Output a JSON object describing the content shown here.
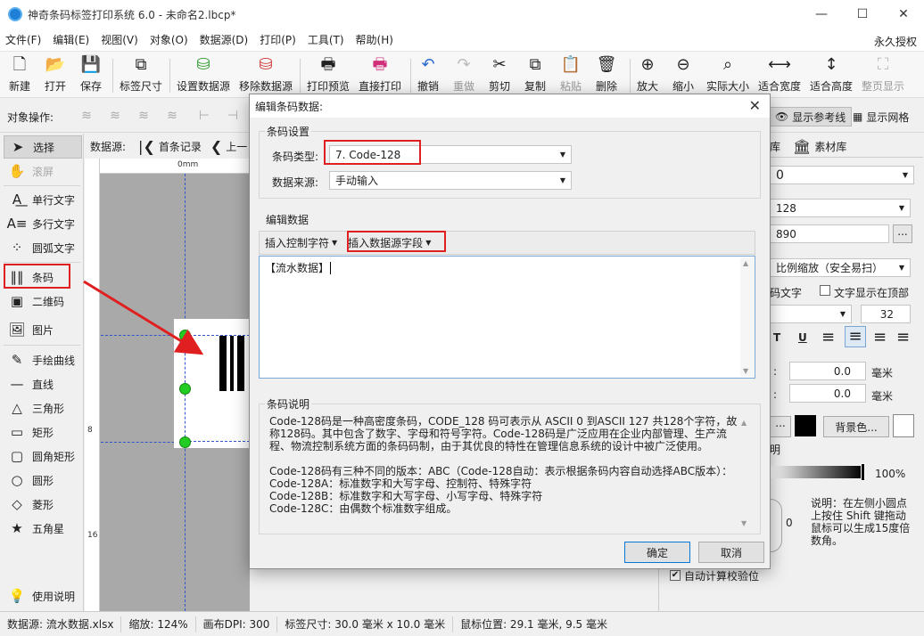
{
  "window": {
    "title": "神奇条码标签打印系统 6.0 - 未命名2.lbcp*",
    "minimize": "—",
    "maximize": "☐",
    "close": "✕"
  },
  "menu": {
    "items": [
      "文件(F)",
      "编辑(E)",
      "视图(V)",
      "对象(O)",
      "数据源(D)",
      "打印(P)",
      "工具(T)",
      "帮助(H)"
    ],
    "right": "永久授权"
  },
  "toolbar": {
    "new": "新建",
    "open": "打开",
    "save": "保存",
    "label_size": "标签尺寸",
    "set_datasource": "设置数据源",
    "remove_datasource": "移除数据源",
    "print_preview": "打印预览",
    "direct_print": "直接打印",
    "undo": "撤销",
    "redo": "重做",
    "cut": "剪切",
    "copy": "复制",
    "paste": "粘贴",
    "delete": "删除",
    "zoom_in": "放大",
    "zoom_out": "缩小",
    "actual_size": "实际大小",
    "fit_width": "适合宽度",
    "fit_height": "适合高度",
    "full_page": "整页显示"
  },
  "ops": {
    "label": "对象操作:",
    "show_guides": "显示参考线",
    "show_grid": "显示网格"
  },
  "tools": {
    "select": "选择",
    "scroll": "滚屏",
    "single_text": "单行文字",
    "multi_text": "多行文字",
    "arc_text": "圆弧文字",
    "barcode": "条码",
    "qrcode": "二维码",
    "image": "图片",
    "freehand": "手绘曲线",
    "line": "直线",
    "triangle": "三角形",
    "rect": "矩形",
    "round_rect": "圆角矩形",
    "circle": "圆形",
    "diamond": "菱形",
    "star": "五角星",
    "help": "使用说明"
  },
  "datasource_bar": {
    "label": "数据源:",
    "first": "首条记录",
    "prev": "上一"
  },
  "ruler": {
    "mm": "0mm",
    "l8": "8",
    "l16": "16"
  },
  "right_panel": {
    "tab_lib": "库",
    "tab_material": "素材库",
    "val_top": "0",
    "val_type": "128",
    "val_data": "890",
    "more_btn": "...",
    "scale_mode": "比例缩放（安全易扫）",
    "show_text_suffix": "码文字",
    "text_on_top": "文字显示在顶部",
    "font_size": "32",
    "b_t": "T",
    "b_u": "U",
    "w_label": ":",
    "w_value": "0.0",
    "w_unit": "毫米",
    "h_label": ":",
    "h_value": "0.0",
    "h_unit": "毫米",
    "dots_btn": "...",
    "bg_btn": "背景色...",
    "transp_label": "明",
    "transp_value": "100%",
    "rot_value": "0",
    "rotate_help": "说明：在左侧小圆点上按住 Shift 键拖动鼠标可以生成15度倍数角。",
    "auto_check": "自动计算校验位"
  },
  "dialog": {
    "title": "编辑条码数据:",
    "close": "✕",
    "group_barcode": "条码设置",
    "type_label": "条码类型:",
    "type_value": "7. Code-128",
    "source_label": "数据来源:",
    "source_value": "手动输入",
    "group_data": "编辑数据",
    "insert_ctrl": "插入控制字符",
    "insert_field": "插入数据源字段",
    "editor_value": "【流水数据】",
    "group_desc": "条码说明",
    "desc_p1": "Code-128码是一种高密度条码，CODE_128 码可表示从 ASCII 0 到ASCII 127 共128个字符，故称128码。其中包含了数字、字母和符号字符。Code-128码是广泛应用在企业内部管理、生产流程、物流控制系统方面的条码码制，由于其优良的特性在管理信息系统的设计中被广泛使用。",
    "desc_l1": "Code-128码有三种不同的版本：ABC（Code-128自动：表示根据条码内容自动选择ABC版本）：",
    "desc_l2": "Code-128A：标准数字和大写字母、控制符、特殊字符",
    "desc_l3": "Code-128B：标准数字和大写字母、小写字母、特殊字符",
    "desc_l4": "Code-128C：由偶数个标准数字组成。",
    "ok": "确定",
    "cancel": "取消"
  },
  "status": {
    "datasource": "数据源: 流水数据.xlsx",
    "zoom": "缩放: 124%",
    "dpi": "画布DPI: 300",
    "size": "标签尺寸: 30.0 毫米 x 10.0 毫米",
    "mouse": "鼠标位置: 29.1 毫米, 9.5 毫米"
  },
  "colors": {
    "highlight": "#e02020",
    "handle": "#22cc22",
    "accent": "#0078d7"
  }
}
